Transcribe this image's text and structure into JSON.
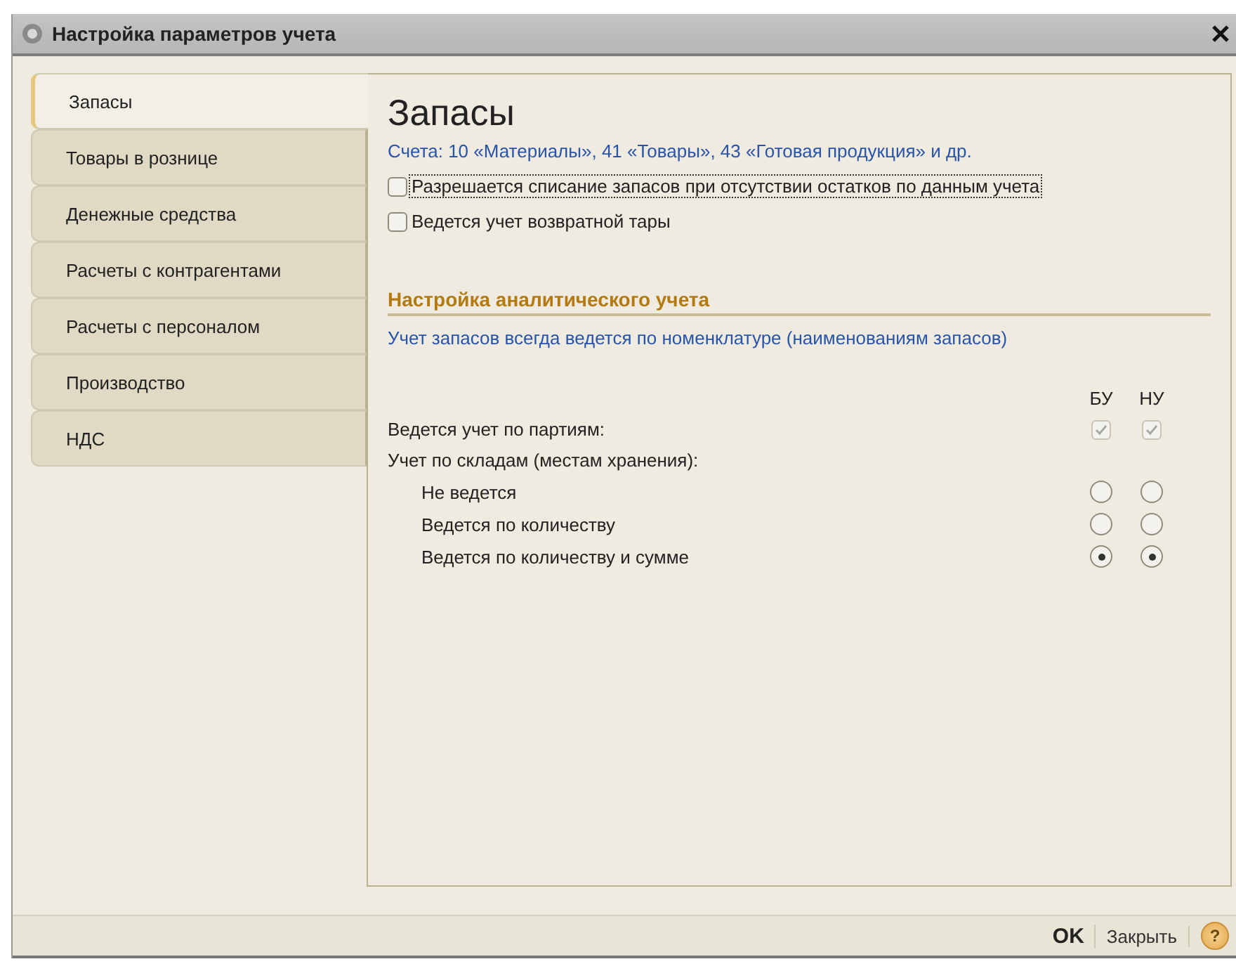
{
  "window": {
    "title": "Настройка параметров учета"
  },
  "tabs": [
    {
      "label": "Запасы",
      "selected": true
    },
    {
      "label": "Товары в рознице",
      "selected": false
    },
    {
      "label": "Денежные средства",
      "selected": false
    },
    {
      "label": "Расчеты с контрагентами",
      "selected": false
    },
    {
      "label": "Расчеты с персоналом",
      "selected": false
    },
    {
      "label": "Производство",
      "selected": false
    },
    {
      "label": "НДС",
      "selected": false
    }
  ],
  "content": {
    "heading": "Запасы",
    "accounts_note": "Счета: 10 «Материалы», 41 «Товары», 43 «Готовая продукция» и др.",
    "checkboxes": [
      {
        "label": "Разрешается списание запасов при отсутствии остатков по данным учета",
        "checked": false,
        "focused": true
      },
      {
        "label": "Ведется учет возвратной тары",
        "checked": false,
        "focused": false
      }
    ],
    "section_title": "Настройка аналитического учета",
    "section_note": "Учет запасов всегда ведется по номенклатуре (наименованиям запасов)",
    "columns": [
      "БУ",
      "НУ"
    ],
    "rows": [
      {
        "kind": "checkbox",
        "label": "Ведется учет по партиям:",
        "values": [
          {
            "checked": true,
            "disabled": true
          },
          {
            "checked": true,
            "disabled": true
          }
        ]
      },
      {
        "kind": "group",
        "label": "Учет по складам (местам хранения):"
      },
      {
        "kind": "radio",
        "label": "Не ведется",
        "values": [
          {
            "selected": false
          },
          {
            "selected": false
          }
        ]
      },
      {
        "kind": "radio",
        "label": "Ведется по количеству",
        "values": [
          {
            "selected": false
          },
          {
            "selected": false
          }
        ]
      },
      {
        "kind": "radio",
        "label": "Ведется по количеству и сумме",
        "values": [
          {
            "selected": true
          },
          {
            "selected": true
          }
        ]
      }
    ]
  },
  "footer": {
    "ok": "OK",
    "close": "Закрыть",
    "help": "?"
  }
}
